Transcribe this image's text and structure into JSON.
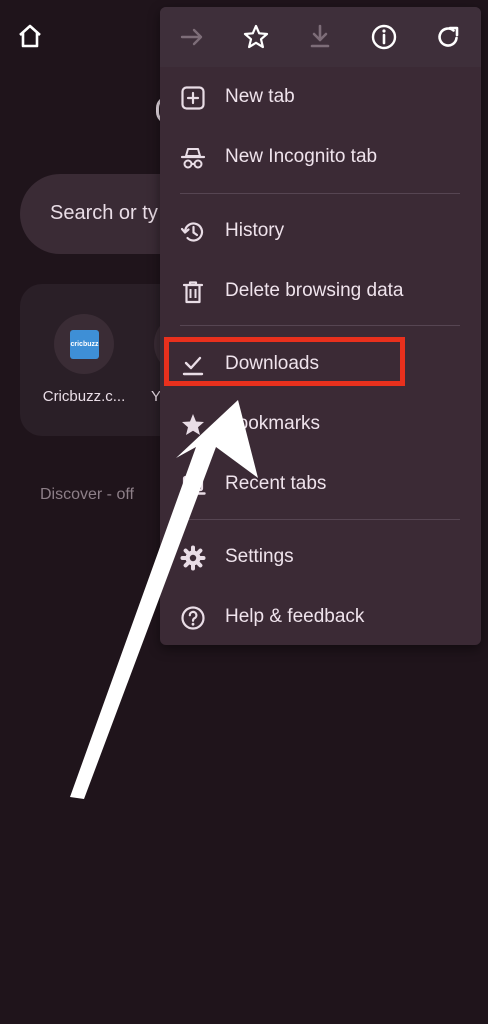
{
  "background": {
    "search_placeholder": "Search or ty",
    "shortcuts": [
      {
        "label": "Cricbuzz.c...",
        "icon": "cricbuzz-logo",
        "logo_text": "cricbuzz"
      },
      {
        "label": "Y",
        "icon": "youtube-logo"
      }
    ],
    "discover_label": "Discover - off"
  },
  "menu": {
    "toolbar": [
      {
        "name": "forward-button",
        "icon": "arrow-right-icon",
        "enabled": false
      },
      {
        "name": "bookmark-star-button",
        "icon": "star-outline-icon",
        "enabled": true
      },
      {
        "name": "download-page-button",
        "icon": "download-icon",
        "enabled": false
      },
      {
        "name": "page-info-button",
        "icon": "info-icon",
        "enabled": true
      },
      {
        "name": "reload-button",
        "icon": "reload-icon",
        "enabled": true
      }
    ],
    "items": [
      {
        "label": "New tab",
        "icon": "plus-box-icon"
      },
      {
        "label": "New Incognito tab",
        "icon": "incognito-icon"
      },
      {
        "label": "History",
        "icon": "history-icon"
      },
      {
        "label": "Delete browsing data",
        "icon": "trash-icon"
      },
      {
        "label": "Downloads",
        "icon": "download-done-icon"
      },
      {
        "label": "Bookmarks",
        "icon": "star-filled-icon"
      },
      {
        "label": "Recent tabs",
        "icon": "laptop-icon"
      },
      {
        "label": "Settings",
        "icon": "gear-icon"
      },
      {
        "label": "Help & feedback",
        "icon": "help-circle-icon"
      }
    ]
  },
  "annotations": {
    "highlight_color": "#e8301d",
    "arrow_color": "#ffffff"
  },
  "colors": {
    "page_bg": "#1f141b",
    "menu_bg": "#3b2a35",
    "text": "#efe3ec",
    "muted_text": "#8d7f88"
  }
}
